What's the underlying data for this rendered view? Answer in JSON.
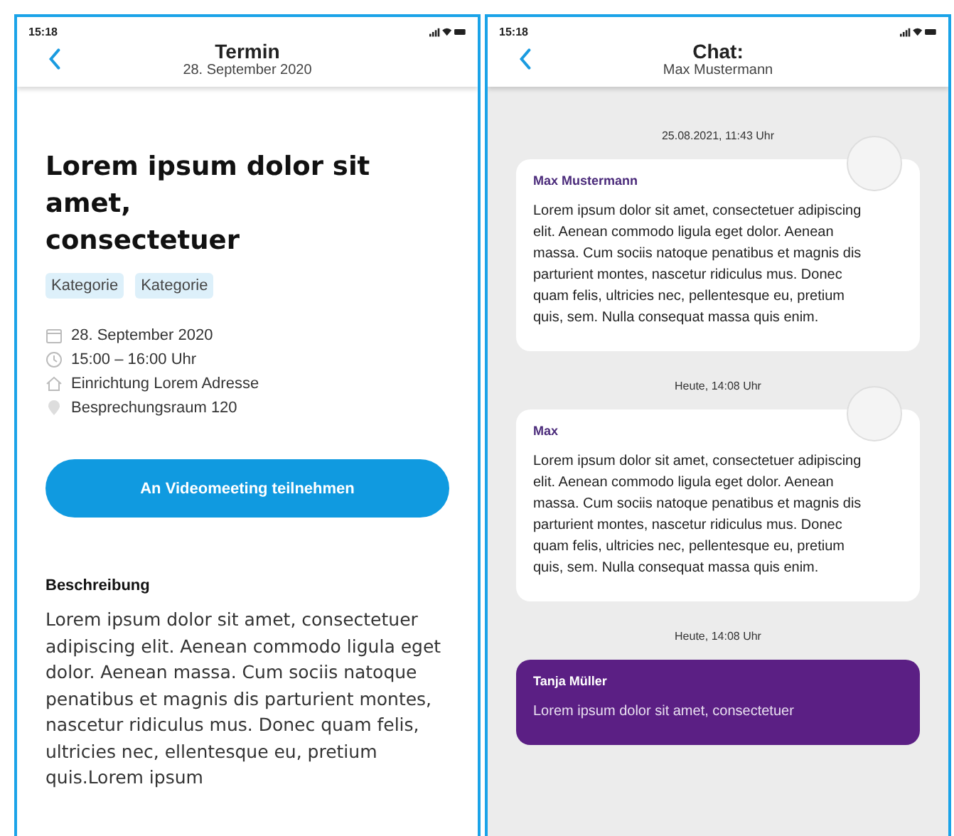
{
  "screens": [
    {
      "kind": "event",
      "status_time": "15:18",
      "header": {
        "title": "Termin",
        "subtitle": "28. September 2020"
      },
      "title": "Lorem ipsum dolor sit\namet,\nconsectetuer",
      "tags": [
        "Kategorie",
        "Kategorie"
      ],
      "details": [
        {
          "kind": "date",
          "text": "28. September 2020"
        },
        {
          "kind": "time",
          "text": "15:00 – 16:00 Uhr"
        },
        {
          "kind": "place",
          "text": "Einrichtung Lorem Adresse"
        },
        {
          "kind": "room",
          "text": "Besprechungsraum 120"
        }
      ],
      "button": "An Videomeeting teilnehmen",
      "section_title": "Beschreibung",
      "description": "Lorem ipsum dolor sit amet, consectetuer adipiscing elit. Aenean commodo ligula eget dolor. Aenean massa. Cum sociis natoque penatibus et magnis dis parturient montes, nascetur ridiculus mus. Donec quam felis, ultricies nec, ellentesque eu, pretium quis.Lorem ipsum"
    },
    {
      "kind": "chat",
      "status_time": "15:18",
      "header": {
        "title": "Chat:",
        "subtitle": "Max Mustermann"
      },
      "messages": [
        {
          "timestamp": "25.08.2021, 11:43 Uhr",
          "kind": "incoming",
          "sender": "Max Mustermann",
          "text": "Lorem ipsum dolor sit amet, consectetuer adipiscing elit. Aenean commodo ligula eget dolor. Aenean massa. Cum sociis natoque penatibus et magnis dis parturient montes, nascetur ridiculus mus. Donec quam felis, ultricies nec, pellentesque eu, pretium quis, sem. Nulla consequat massa quis enim."
        },
        {
          "timestamp": "Heute, 14:08 Uhr",
          "kind": "incoming",
          "sender": "Max",
          "text": "Lorem ipsum dolor sit amet, consectetuer adipiscing elit. Aenean commodo ligula eget dolor. Aenean massa. Cum sociis natoque penatibus et magnis dis parturient montes, nascetur ridiculus mus. Donec quam felis, ultricies nec, pellentesque eu, pretium quis, sem. Nulla consequat massa quis enim."
        },
        {
          "timestamp": "Heute, 14:08 Uhr",
          "kind": "outgoing",
          "sender": "Tanja Müller",
          "text": "Lorem ipsum dolor sit amet, consectetuer"
        }
      ]
    }
  ]
}
